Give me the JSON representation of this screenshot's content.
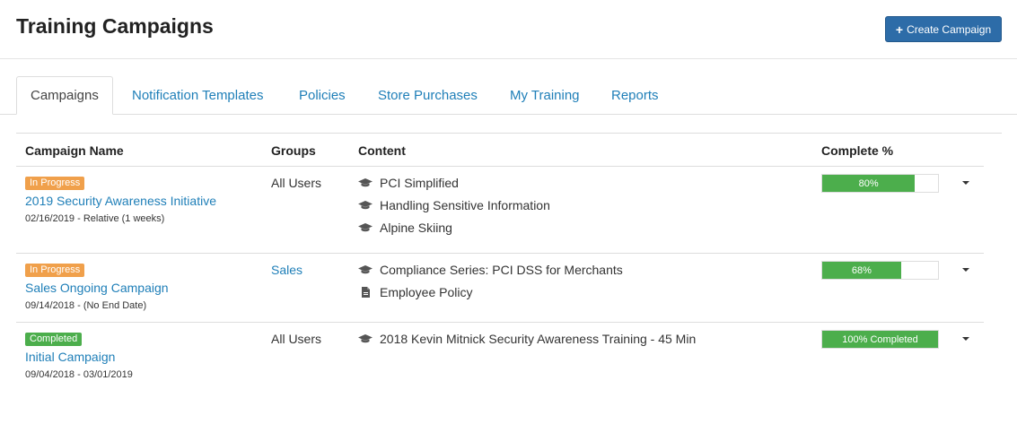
{
  "header": {
    "title": "Training Campaigns",
    "create_button_label": "Create Campaign",
    "create_button_icon": "plus-icon"
  },
  "tabs": [
    {
      "label": "Campaigns",
      "active": true
    },
    {
      "label": "Notification Templates",
      "active": false
    },
    {
      "label": "Policies",
      "active": false
    },
    {
      "label": "Store Purchases",
      "active": false
    },
    {
      "label": "My Training",
      "active": false
    },
    {
      "label": "Reports",
      "active": false
    }
  ],
  "table": {
    "columns": [
      "Campaign Name",
      "Groups",
      "Content",
      "Complete %"
    ],
    "rows": [
      {
        "status": "In Progress",
        "name": "2019 Security Awareness Initiative",
        "date": "02/16/2019 - Relative (1 weeks)",
        "groups": "All Users",
        "content": [
          {
            "icon": "graduation-cap-icon",
            "title": "PCI Simplified"
          },
          {
            "icon": "graduation-cap-icon",
            "title": "Handling Sensitive Information"
          },
          {
            "icon": "graduation-cap-icon",
            "title": "Alpine Skiing"
          }
        ],
        "complete": 0.8,
        "complete_label": "80%"
      },
      {
        "status": "In Progress",
        "name": "Sales Ongoing Campaign",
        "date": "09/14/2018 - (No End Date)",
        "groups": "Sales",
        "content": [
          {
            "icon": "graduation-cap-icon",
            "title": "Compliance Series: PCI DSS for Merchants"
          },
          {
            "icon": "document-icon",
            "title": "Employee Policy"
          }
        ],
        "complete": 0.68,
        "complete_label": "68%"
      },
      {
        "status": "Completed",
        "name": "Initial Campaign",
        "date": "09/04/2018 - 03/01/2019",
        "groups": "All Users",
        "content": [
          {
            "icon": "graduation-cap-icon",
            "title": "2018 Kevin Mitnick Security Awareness Training - 45 Min"
          }
        ],
        "complete": 1.0,
        "complete_label": "100% Completed"
      }
    ]
  },
  "colors": {
    "primary_button": "#2d6ca8",
    "link": "#1f7fb8",
    "in_progress_badge": "#f0a04b",
    "completed_badge": "#4cae4c",
    "progress_fill": "#4cae4c"
  }
}
